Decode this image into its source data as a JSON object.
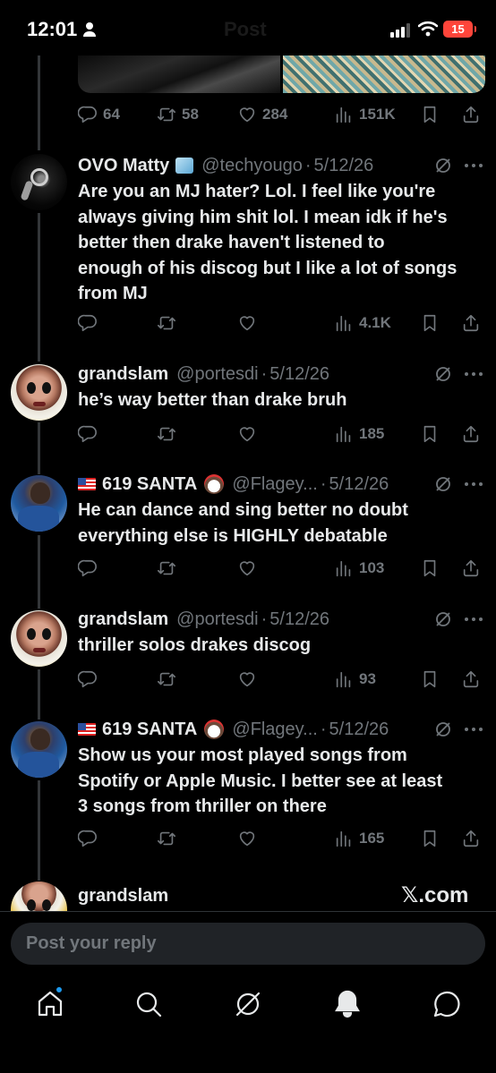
{
  "status_bar": {
    "time": "12:01",
    "battery": "15",
    "ghost_title": "Post"
  },
  "top_post": {
    "replies": "64",
    "reposts": "58",
    "likes": "284",
    "views": "151K"
  },
  "posts": [
    {
      "display_name": "OVO Matty",
      "handle": "@techyougo",
      "date": "5/12/26",
      "lines": [
        "Are you an MJ hater? Lol. I feel like you're",
        "always giving him shit lol. I mean idk if he's",
        "better then drake haven't listened to",
        "enough of his discog but I like a lot of songs",
        "from MJ"
      ],
      "replies": "",
      "reposts": "",
      "likes": "",
      "views": "4.1K"
    },
    {
      "display_name": "grandslam",
      "handle": "@portesdi",
      "date": "5/12/26",
      "lines": [
        "he’s way better than drake bruh"
      ],
      "views": "185"
    },
    {
      "display_name": "619 SANTA",
      "handle": "@Flagey...",
      "date": "5/12/26",
      "lines": [
        "He can dance and sing better no doubt",
        "everything else is HIGHLY debatable"
      ],
      "views": "103"
    },
    {
      "display_name": "grandslam",
      "handle": "@portesdi",
      "date": "5/12/26",
      "lines": [
        "thriller solos drakes discog"
      ],
      "views": "93"
    },
    {
      "display_name": "619 SANTA",
      "handle": "@Flagey...",
      "date": "5/12/26",
      "lines": [
        "Show us your most played songs from",
        "Spotify or Apple Music. I better see at least",
        "3 songs from thriller on there"
      ],
      "views": "165"
    },
    {
      "display_name": "grandslam"
    }
  ],
  "watermark": "𝕏.com",
  "reply_bar": {
    "placeholder": "Post your reply"
  },
  "icons": {
    "reply": "reply-icon",
    "repost": "repost-icon",
    "like": "heart-icon",
    "views": "views-icon",
    "bookmark": "bookmark-icon",
    "share": "share-icon",
    "grok": "grok-icon",
    "more": "more-icon"
  },
  "tabs": [
    "home",
    "search",
    "grok",
    "notifications",
    "messages"
  ],
  "colors": {
    "background": "#000000",
    "text": "#e7e9ea",
    "muted": "#71767b",
    "accent": "#1d9bf0",
    "battery": "#ff453a"
  }
}
